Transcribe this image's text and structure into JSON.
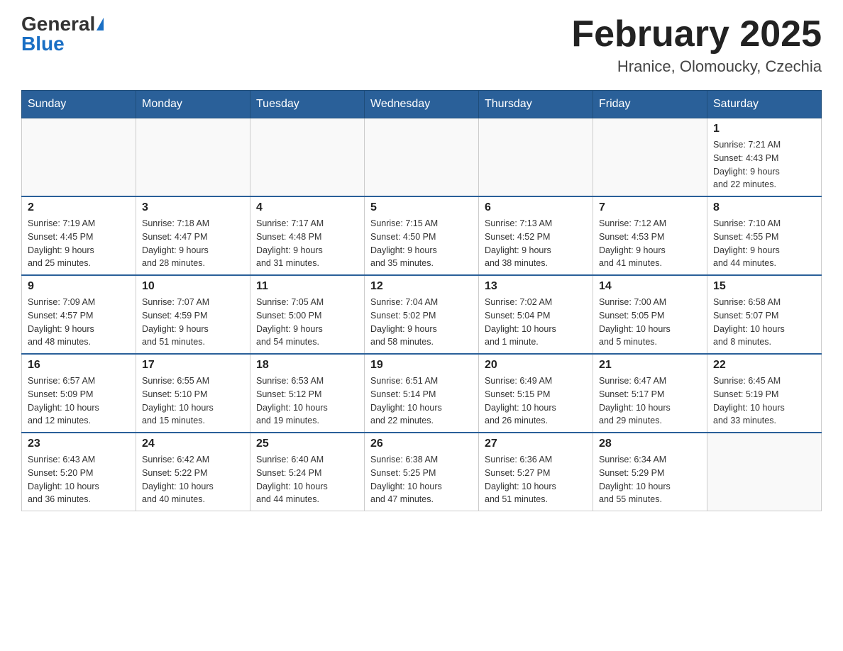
{
  "header": {
    "logo_general": "General",
    "logo_blue": "Blue",
    "month_title": "February 2025",
    "location": "Hranice, Olomoucky, Czechia"
  },
  "weekdays": [
    "Sunday",
    "Monday",
    "Tuesday",
    "Wednesday",
    "Thursday",
    "Friday",
    "Saturday"
  ],
  "weeks": [
    {
      "days": [
        {
          "num": "",
          "info": ""
        },
        {
          "num": "",
          "info": ""
        },
        {
          "num": "",
          "info": ""
        },
        {
          "num": "",
          "info": ""
        },
        {
          "num": "",
          "info": ""
        },
        {
          "num": "",
          "info": ""
        },
        {
          "num": "1",
          "info": "Sunrise: 7:21 AM\nSunset: 4:43 PM\nDaylight: 9 hours\nand 22 minutes."
        }
      ]
    },
    {
      "days": [
        {
          "num": "2",
          "info": "Sunrise: 7:19 AM\nSunset: 4:45 PM\nDaylight: 9 hours\nand 25 minutes."
        },
        {
          "num": "3",
          "info": "Sunrise: 7:18 AM\nSunset: 4:47 PM\nDaylight: 9 hours\nand 28 minutes."
        },
        {
          "num": "4",
          "info": "Sunrise: 7:17 AM\nSunset: 4:48 PM\nDaylight: 9 hours\nand 31 minutes."
        },
        {
          "num": "5",
          "info": "Sunrise: 7:15 AM\nSunset: 4:50 PM\nDaylight: 9 hours\nand 35 minutes."
        },
        {
          "num": "6",
          "info": "Sunrise: 7:13 AM\nSunset: 4:52 PM\nDaylight: 9 hours\nand 38 minutes."
        },
        {
          "num": "7",
          "info": "Sunrise: 7:12 AM\nSunset: 4:53 PM\nDaylight: 9 hours\nand 41 minutes."
        },
        {
          "num": "8",
          "info": "Sunrise: 7:10 AM\nSunset: 4:55 PM\nDaylight: 9 hours\nand 44 minutes."
        }
      ]
    },
    {
      "days": [
        {
          "num": "9",
          "info": "Sunrise: 7:09 AM\nSunset: 4:57 PM\nDaylight: 9 hours\nand 48 minutes."
        },
        {
          "num": "10",
          "info": "Sunrise: 7:07 AM\nSunset: 4:59 PM\nDaylight: 9 hours\nand 51 minutes."
        },
        {
          "num": "11",
          "info": "Sunrise: 7:05 AM\nSunset: 5:00 PM\nDaylight: 9 hours\nand 54 minutes."
        },
        {
          "num": "12",
          "info": "Sunrise: 7:04 AM\nSunset: 5:02 PM\nDaylight: 9 hours\nand 58 minutes."
        },
        {
          "num": "13",
          "info": "Sunrise: 7:02 AM\nSunset: 5:04 PM\nDaylight: 10 hours\nand 1 minute."
        },
        {
          "num": "14",
          "info": "Sunrise: 7:00 AM\nSunset: 5:05 PM\nDaylight: 10 hours\nand 5 minutes."
        },
        {
          "num": "15",
          "info": "Sunrise: 6:58 AM\nSunset: 5:07 PM\nDaylight: 10 hours\nand 8 minutes."
        }
      ]
    },
    {
      "days": [
        {
          "num": "16",
          "info": "Sunrise: 6:57 AM\nSunset: 5:09 PM\nDaylight: 10 hours\nand 12 minutes."
        },
        {
          "num": "17",
          "info": "Sunrise: 6:55 AM\nSunset: 5:10 PM\nDaylight: 10 hours\nand 15 minutes."
        },
        {
          "num": "18",
          "info": "Sunrise: 6:53 AM\nSunset: 5:12 PM\nDaylight: 10 hours\nand 19 minutes."
        },
        {
          "num": "19",
          "info": "Sunrise: 6:51 AM\nSunset: 5:14 PM\nDaylight: 10 hours\nand 22 minutes."
        },
        {
          "num": "20",
          "info": "Sunrise: 6:49 AM\nSunset: 5:15 PM\nDaylight: 10 hours\nand 26 minutes."
        },
        {
          "num": "21",
          "info": "Sunrise: 6:47 AM\nSunset: 5:17 PM\nDaylight: 10 hours\nand 29 minutes."
        },
        {
          "num": "22",
          "info": "Sunrise: 6:45 AM\nSunset: 5:19 PM\nDaylight: 10 hours\nand 33 minutes."
        }
      ]
    },
    {
      "days": [
        {
          "num": "23",
          "info": "Sunrise: 6:43 AM\nSunset: 5:20 PM\nDaylight: 10 hours\nand 36 minutes."
        },
        {
          "num": "24",
          "info": "Sunrise: 6:42 AM\nSunset: 5:22 PM\nDaylight: 10 hours\nand 40 minutes."
        },
        {
          "num": "25",
          "info": "Sunrise: 6:40 AM\nSunset: 5:24 PM\nDaylight: 10 hours\nand 44 minutes."
        },
        {
          "num": "26",
          "info": "Sunrise: 6:38 AM\nSunset: 5:25 PM\nDaylight: 10 hours\nand 47 minutes."
        },
        {
          "num": "27",
          "info": "Sunrise: 6:36 AM\nSunset: 5:27 PM\nDaylight: 10 hours\nand 51 minutes."
        },
        {
          "num": "28",
          "info": "Sunrise: 6:34 AM\nSunset: 5:29 PM\nDaylight: 10 hours\nand 55 minutes."
        },
        {
          "num": "",
          "info": ""
        }
      ]
    }
  ]
}
